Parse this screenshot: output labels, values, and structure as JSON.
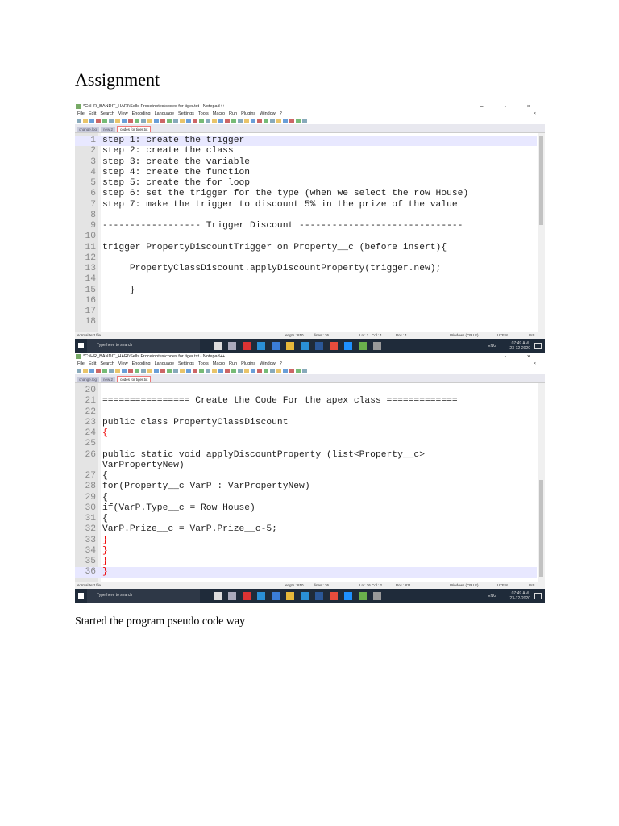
{
  "heading": "Assignment",
  "caption": "Started the program pseudo code way",
  "notepad": {
    "title": "*C:\\HR_BANDIT_HARI\\Sells Froce\\notes\\codes for tiger.txt - Notepad++",
    "window_controls": "– ▫ ×",
    "close_doc": "×",
    "menu": [
      "File",
      "Edit",
      "Search",
      "View",
      "Encoding",
      "Language",
      "Settings",
      "Tools",
      "Macro",
      "Run",
      "Plugins",
      "Window",
      "?"
    ],
    "tabs": [
      "change.log",
      "new 2",
      "codes for tiger.txt"
    ],
    "taskbar": {
      "search_placeholder": "Type here to search",
      "lang": "ENG",
      "time": "07:49 AM",
      "date": "23-12-2020"
    }
  },
  "shot1": {
    "lines": [
      {
        "n": "1",
        "t": "step 1: create the trigger"
      },
      {
        "n": "2",
        "t": "step 2: create the class"
      },
      {
        "n": "3",
        "t": "step 3: create the variable"
      },
      {
        "n": "4",
        "t": "step 4: create the function"
      },
      {
        "n": "5",
        "t": "step 5: create the for loop"
      },
      {
        "n": "6",
        "t": "step 6: set the trigger for the type (when we select the row House)"
      },
      {
        "n": "7",
        "t": "step 7: make the trigger to discount 5% in the prize of the value"
      },
      {
        "n": "8",
        "t": ""
      },
      {
        "n": "9",
        "t": "------------------ Trigger Discount ------------------------------"
      },
      {
        "n": "10",
        "t": ""
      },
      {
        "n": "11",
        "t": "trigger PropertyDiscountTrigger on Property__c (before insert){"
      },
      {
        "n": "12",
        "t": ""
      },
      {
        "n": "13",
        "t": "     PropertyClassDiscount.applyDiscountProperty(trigger.new);"
      },
      {
        "n": "14",
        "t": ""
      },
      {
        "n": "15",
        "t": "     }"
      },
      {
        "n": "16",
        "t": ""
      },
      {
        "n": "17",
        "t": ""
      },
      {
        "n": "18",
        "t": ""
      }
    ],
    "status": {
      "type": "Normal text file",
      "length": "length : 810",
      "lines": "lines : 36",
      "ln": "Ln : 1",
      "col": "Col : 1",
      "pos": "Pos : 1",
      "eol": "Windows (CR LF)",
      "enc": "UTF-8",
      "mode": "INS"
    }
  },
  "shot2": {
    "lines": [
      {
        "n": "20",
        "t": ""
      },
      {
        "n": "21",
        "t": "================ Create the Code For the apex class ============="
      },
      {
        "n": "22",
        "t": ""
      },
      {
        "n": "23",
        "t": "public class PropertyClassDiscount"
      },
      {
        "n": "24",
        "t": "{",
        "red": true
      },
      {
        "n": "25",
        "t": ""
      },
      {
        "n": "26",
        "t": "public static void applyDiscountProperty (list<Property__c>"
      },
      {
        "n": "",
        "t": "VarPropertyNew)"
      },
      {
        "n": "27",
        "t": "{"
      },
      {
        "n": "28",
        "t": "for(Property__c VarP : VarPropertyNew)"
      },
      {
        "n": "29",
        "t": "{"
      },
      {
        "n": "30",
        "t": "if(VarP.Type__c = Row House)"
      },
      {
        "n": "31",
        "t": "{"
      },
      {
        "n": "32",
        "t": "VarP.Prize__c = VarP.Prize__c-5;"
      },
      {
        "n": "33",
        "t": "}",
        "red": true
      },
      {
        "n": "34",
        "t": "}",
        "red": true
      },
      {
        "n": "35",
        "t": "}",
        "red": true
      },
      {
        "n": "36",
        "t": "}",
        "red": true,
        "hl": true
      }
    ],
    "status": {
      "type": "Normal text file",
      "length": "length : 810",
      "lines": "lines : 36",
      "ln": "Ln : 36",
      "col": "Col : 2",
      "pos": "Pos : 811",
      "eol": "Windows (CR LF)",
      "enc": "UTF-8",
      "mode": "INS"
    }
  }
}
